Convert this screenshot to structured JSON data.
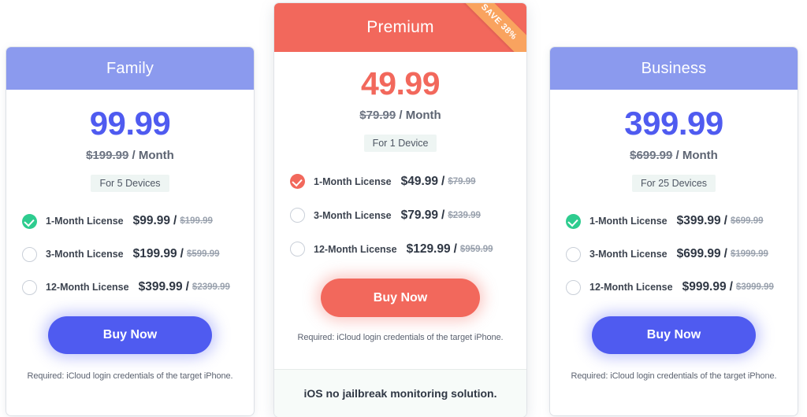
{
  "plans": [
    {
      "id": "family",
      "title": "Family",
      "accent": "#8b9aee",
      "price_color": "#4f5bf0",
      "price": "99.99",
      "old_price": "$199.99",
      "period": "/ Month",
      "devices": "For 5 Devices",
      "licenses": [
        {
          "name": "1-Month License",
          "price": "$99.99",
          "old": "$199.99",
          "selected": true
        },
        {
          "name": "3-Month License",
          "price": "$199.99",
          "old": "$599.99",
          "selected": false
        },
        {
          "name": "12-Month License",
          "price": "$399.99",
          "old": "$2399.99",
          "selected": false
        }
      ],
      "buy_label": "Buy Now",
      "required_note": "Required: iCloud login credentials of the target iPhone."
    },
    {
      "id": "premium",
      "title": "Premium",
      "accent": "#f2685c",
      "price_color": "#f2685c",
      "ribbon": "SAVE 38%",
      "ribbon_color": "#f9a35f",
      "price": "49.99",
      "old_price": "$79.99",
      "period": "/ Month",
      "devices": "For 1 Device",
      "licenses": [
        {
          "name": "1-Month License",
          "price": "$49.99",
          "old": "$79.99",
          "selected": true
        },
        {
          "name": "3-Month License",
          "price": "$79.99",
          "old": "$239.99",
          "selected": false
        },
        {
          "name": "12-Month License",
          "price": "$129.99",
          "old": "$959.99",
          "selected": false
        }
      ],
      "buy_label": "Buy Now",
      "required_note": "Required: iCloud login credentials of the target iPhone.",
      "footer_text": "iOS no jailbreak monitoring solution."
    },
    {
      "id": "business",
      "title": "Business",
      "accent": "#8b9aee",
      "price_color": "#4f5bf0",
      "price": "399.99",
      "old_price": "$699.99",
      "period": "/ Month",
      "devices": "For 25 Devices",
      "licenses": [
        {
          "name": "1-Month License",
          "price": "$399.99",
          "old": "$699.99",
          "selected": true
        },
        {
          "name": "3-Month License",
          "price": "$699.99",
          "old": "$1999.99",
          "selected": false
        },
        {
          "name": "12-Month License",
          "price": "$999.99",
          "old": "$3999.99",
          "selected": false
        }
      ],
      "buy_label": "Buy Now",
      "required_note": "Required: iCloud login credentials of the target iPhone."
    }
  ]
}
